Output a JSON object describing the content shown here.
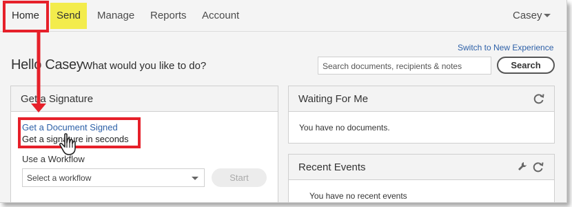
{
  "nav": {
    "items": [
      {
        "label": "Home"
      },
      {
        "label": "Send"
      },
      {
        "label": "Manage"
      },
      {
        "label": "Reports"
      },
      {
        "label": "Account"
      }
    ],
    "user": "Casey"
  },
  "header": {
    "switch_link": "Switch to New Experience",
    "greeting": "Hello Casey",
    "prompt": "What would you like to do?",
    "search_placeholder": "Search documents, recipients & notes",
    "search_button": "Search"
  },
  "get_signature": {
    "title": "Get a Signature",
    "link": "Get a Document Signed",
    "description": "Get a signature in seconds",
    "workflow_label": "Use a Workflow",
    "workflow_select": "Select a workflow",
    "start_button": "Start"
  },
  "waiting": {
    "title": "Waiting For Me",
    "message": "You have no documents."
  },
  "recent": {
    "title": "Recent Events",
    "message": "You have no recent events"
  },
  "colors": {
    "highlight": "#e6202a",
    "send_bg": "#f3ec4c",
    "link": "#2c5fa7"
  }
}
